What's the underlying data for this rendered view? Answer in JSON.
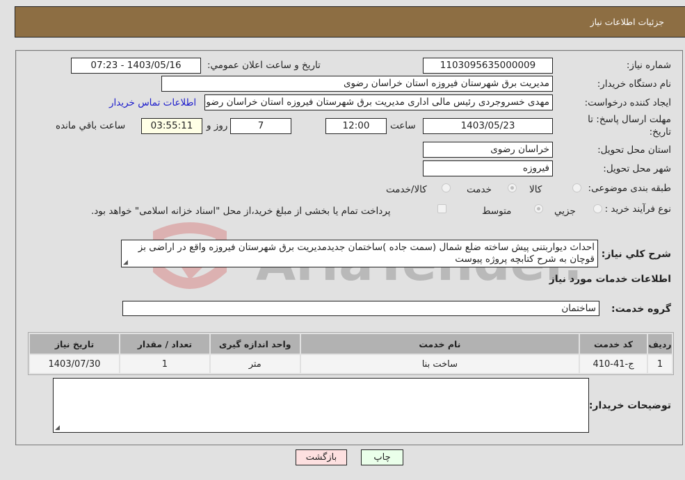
{
  "header": {
    "title": "جزئیات اطلاعات نیاز"
  },
  "form": {
    "need_number_label": "شماره نیاز:",
    "need_number": "1103095635000009",
    "announce_label": "تاریخ و ساعت اعلان عمومي:",
    "announce_value": "1403/05/16 - 07:23",
    "buyer_org_label": "نام دستگاه خریدار:",
    "buyer_org": "مدیریت برق شهرستان فیروزه استان خراسان رضوی",
    "creator_label": "ایجاد کننده درخواست:",
    "creator": "مهدی خسروجردی رئیس مالی اداری مدیریت برق شهرستان فیروزه استان خراسان رضوی",
    "contact_link": "اطلاعات تماس خریدار",
    "deadline_label_1": "مهلت ارسال پاسخ: تا",
    "deadline_label_2": "تاریخ:",
    "deadline_date": "1403/05/23",
    "time_label": "ساعت",
    "deadline_time": "12:00",
    "days": "7",
    "days_label": "روز و",
    "remaining": "03:55:11",
    "remaining_label": "ساعت باقي مانده",
    "province_label": "استان محل تحویل:",
    "province": "خراسان رضوی",
    "city_label": "شهر محل تحویل:",
    "city": "فیروزه",
    "category_label": "طبقه بندی موضوعی:",
    "category_options": [
      {
        "label": "کالا",
        "selected": false
      },
      {
        "label": "خدمت",
        "selected": true
      },
      {
        "label": "کالا/خدمت",
        "selected": false
      }
    ],
    "process_label": "نوع فرآیند خرید :",
    "process_options": [
      {
        "label": "جزيي",
        "selected": false
      },
      {
        "label": "متوسط",
        "selected": true
      }
    ],
    "treasury_note": "پرداخت تمام یا بخشی از مبلغ خرید،از محل \"اسناد خزانه اسلامی\" خواهد بود.",
    "treasury_checked": false,
    "description_label": "شرح كلي نياز:",
    "description": "احداث دیواربتنی پیش ساخته ضلع شمال (سمت جاده )ساختمان جدیدمدیریت برق شهرستان فیروزه واقع در اراضی بز قوچان به شرح کتابچه پروژه پیوست"
  },
  "services": {
    "section_title": "اطلاعات خدمات مورد نیاز",
    "group_label": "گروه خدمت:",
    "group_value": "ساختمان",
    "columns": [
      "ردیف",
      "کد خدمت",
      "نام خدمت",
      "واحد اندازه گیری",
      "تعداد / مقدار",
      "تاریخ نیاز"
    ],
    "rows": [
      {
        "row": "1",
        "code": "ج-41-410",
        "name": "ساخت بنا",
        "unit": "متر",
        "qty": "1",
        "date": "1403/07/30"
      }
    ]
  },
  "buyer_notes": {
    "label": "توضیحات خریدار:",
    "value": ""
  },
  "buttons": {
    "print": "چاپ",
    "back": "بازگشت"
  },
  "watermark": {
    "text": "AriaTender.net"
  }
}
